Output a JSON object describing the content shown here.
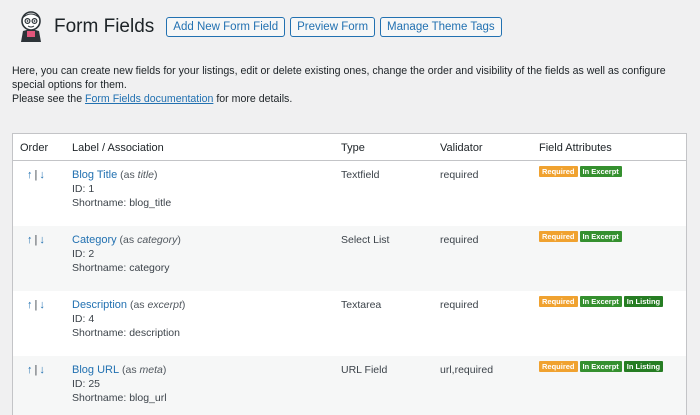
{
  "header": {
    "title": "Form Fields",
    "buttons": [
      "Add New Form Field",
      "Preview Form",
      "Manage Theme Tags"
    ]
  },
  "intro": {
    "line1": "Here, you can create new fields for your listings, edit or delete existing ones, change the order and visibility of the fields as well as configure special options for them.",
    "line2_prefix": "Please see the ",
    "line2_link": "Form Fields documentation",
    "line2_suffix": " for more details."
  },
  "table": {
    "headers": {
      "order": "Order",
      "label": "Label / Association",
      "type": "Type",
      "validator": "Validator",
      "attributes": "Field Attributes"
    },
    "arrow_up": "↑",
    "arrow_sep": "|",
    "arrow_down": "↓",
    "rows": [
      {
        "title": "Blog Title",
        "assoc_prefix": " (as ",
        "assoc": "title",
        "assoc_suffix": ")",
        "id": "ID: 1",
        "shortname": "Shortname: blog_title",
        "type": "Textfield",
        "validator": "required",
        "badges": [
          "Required",
          "In Excerpt"
        ]
      },
      {
        "title": "Category",
        "assoc_prefix": " (as ",
        "assoc": "category",
        "assoc_suffix": ")",
        "id": "ID: 2",
        "shortname": "Shortname: category",
        "type": "Select List",
        "validator": "required",
        "badges": [
          "Required",
          "In Excerpt"
        ]
      },
      {
        "title": "Description",
        "assoc_prefix": " (as ",
        "assoc": "excerpt",
        "assoc_suffix": ")",
        "id": "ID: 4",
        "shortname": "Shortname: description",
        "type": "Textarea",
        "validator": "required",
        "badges": [
          "Required",
          "In Excerpt",
          "In Listing"
        ]
      },
      {
        "title": "Blog URL",
        "assoc_prefix": " (as ",
        "assoc": "meta",
        "assoc_suffix": ")",
        "id": "ID: 25",
        "shortname": "Shortname: blog_url",
        "type": "URL Field",
        "validator": "url,required",
        "badges": [
          "Required",
          "In Excerpt",
          "In Listing"
        ]
      }
    ]
  }
}
